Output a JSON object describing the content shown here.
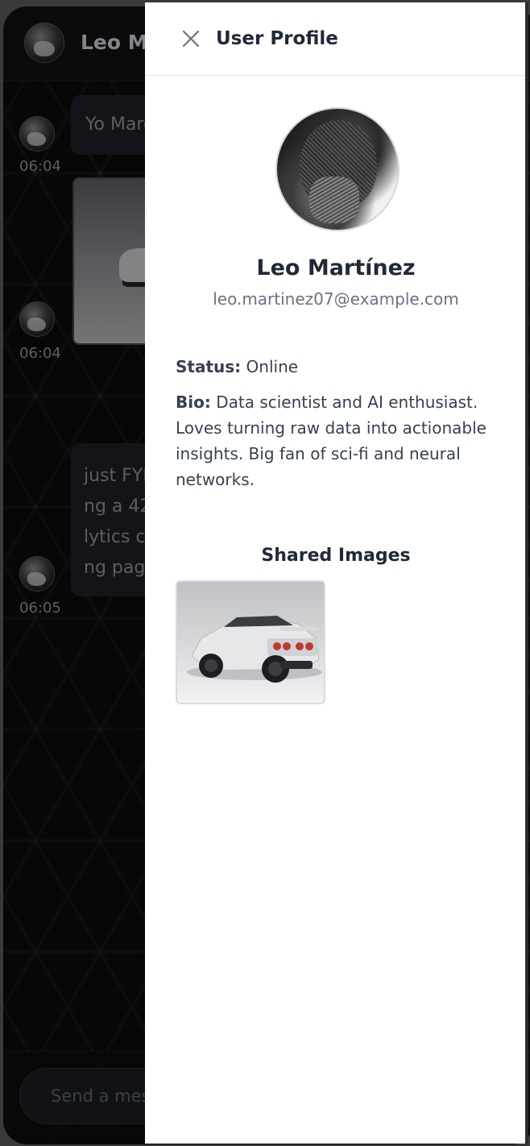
{
  "chat": {
    "contact_name": "Leo Martínez",
    "messages": [
      {
        "time": "06:04",
        "text": "Yo Marco"
      },
      {
        "time": "06:04"
      },
      {
        "time": "06:05",
        "lines": [
          "just FYI",
          "ng a 42",
          "lytics c",
          "ng pag"
        ]
      }
    ],
    "input_placeholder": "Send a message"
  },
  "profile": {
    "title": "User Profile",
    "name": "Leo Martínez",
    "email": "leo.martinez07@example.com",
    "status_label": "Status:",
    "status_value": "Online",
    "bio_label": "Bio:",
    "bio_text": "Data scientist and AI enthusiast. Loves turning raw data into actionable insights. Big fan of sci-fi and neural networks.",
    "shared_images_title": "Shared Images"
  },
  "icons": {
    "close": "close-icon"
  }
}
